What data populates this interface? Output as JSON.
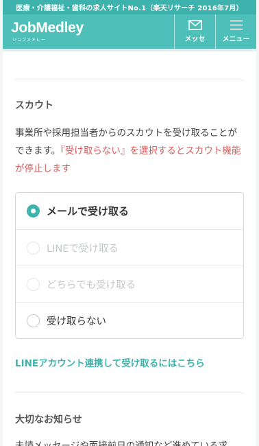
{
  "banner": {
    "text": "医療・介護福祉・歯科の求人サイトNo.1（楽天リサーチ 2016年7月）"
  },
  "header": {
    "logo_text": "JobMedley",
    "logo_sub": "ジョブメドレー",
    "message_label": "メッセ",
    "menu_label": "メニュー",
    "accent_color": "#4fc0b9"
  },
  "scout": {
    "title": "スカウト",
    "description_plain": "事業所や採用担当者からのスカウトを受け取ることができます。",
    "description_warning": "『受け取らない』を選択するとスカウト機能が停止します",
    "options": [
      {
        "label": "メールで受け取る",
        "checked": true,
        "disabled": false
      },
      {
        "label": "LINEで受け取る",
        "checked": false,
        "disabled": true
      },
      {
        "label": "どちらでも受け取る",
        "checked": false,
        "disabled": true
      },
      {
        "label": "受け取らない",
        "checked": false,
        "disabled": false
      }
    ],
    "line_link": "LINEアカウント連携して受け取るにはこちら"
  },
  "notice": {
    "title": "大切なお知らせ",
    "description": "未読メッセージや面接前日の通知など進めている求"
  }
}
